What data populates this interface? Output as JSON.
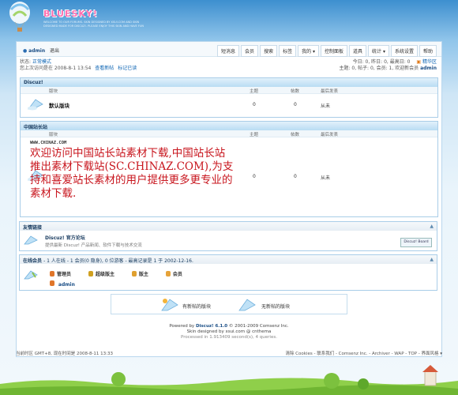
{
  "site": {
    "logo": "BLUESKY!",
    "tagline": "WELCOME TO OUR FORUMS. SKIN DESIGNED BY XSUI.COM AND SKIN DESIGNED MADE FOR DISCUZ!. PLEASE ENJOY THIS SKIN AND HAVE FUN"
  },
  "topbar": {
    "username": "admin",
    "logout": "退出",
    "nav": [
      "短消息",
      "会员",
      "搜索",
      "标签",
      "我的 ▾",
      "控制面板",
      "道具",
      "统计 ▾",
      "系统设置",
      "帮助"
    ]
  },
  "status": {
    "label": "状态:",
    "state": "正常模式",
    "last_visit": "您上次访问是在  2008-8-1 13:54",
    "new_posts": "查看新帖",
    "mark_read": "标记已读"
  },
  "stats": {
    "line1": "今日: 0, 昨日: 0, 最高日: 0",
    "digest": "精华区",
    "line2": "主题: 0, 帖子: 0, 会员: 1, 欢迎新会员",
    "new_member": "admin"
  },
  "columns": {
    "forum": "版块",
    "topics": "主题",
    "posts": "帖数",
    "last_post": "最后发表"
  },
  "category1": {
    "title": "Discuz!",
    "forum": {
      "name": "默认版块",
      "topics": "0",
      "posts": "0",
      "last": "从未"
    }
  },
  "category2": {
    "title": "中国站长站",
    "forum": {
      "url": "WWW.CHINAZ.COM",
      "name": "欢迎访问中国站长站素材下载,中国站长站推出素材下载站(SC.CHINAZ.COM),为支持和喜爱站长素材的用户提供更多更专业的素材下载.",
      "topics": "0",
      "posts": "0",
      "last": "从未"
    }
  },
  "links": {
    "title": "友情链接",
    "name": "Discuz! 官方论坛",
    "desc": "提供最新 Discuz! 产品新闻、软件下载与技术交流",
    "badge": "Discuz! Board"
  },
  "online": {
    "title": "在线会员",
    "summary": "- 1 人在线 - 1 会员(0 隐身), 0 位游客 - 最高记录是 1 于 2002-12-16.",
    "legend": [
      {
        "label": "管理员",
        "color": "#e0762a"
      },
      {
        "label": "超级版主",
        "color": "#d0a020"
      },
      {
        "label": "版主",
        "color": "#e0a030"
      },
      {
        "label": "会员",
        "color": "#e6a33a"
      }
    ],
    "user": "admin"
  },
  "legend": {
    "new": "有新帖的版块",
    "none": "无新帖的版块"
  },
  "footer": {
    "powered_prefix": "Powered by",
    "powered_product": "Discuz! 6.1.0",
    "powered_suffix": "© 2001-2009 Comsenz Inc.",
    "skin": "Skin designed by xsui.com @ cnthema",
    "processed": "Processed in 1.913409 second(s), 4 queries."
  },
  "bottom": {
    "timezone": "当前时区 GMT+8, 现在时间是 2008-8-11 13:33",
    "links": "清除 Cookies - 联系我们 - Comsenz Inc. - Archiver - WAP - TOP - 界面风格 ▾"
  },
  "colors": {
    "accent": "#1a4e86",
    "red_text": "#c8161e",
    "border": "#a9cde8"
  }
}
